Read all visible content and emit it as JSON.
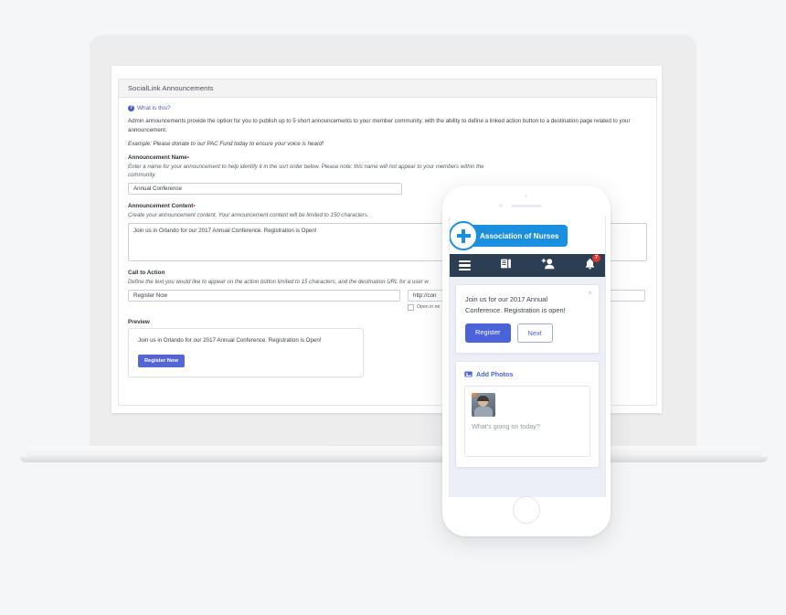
{
  "admin": {
    "card_title": "SocialLink Announcements",
    "what_is_this": "What is this?",
    "intro_paragraph": "Admin announcements provide the option for you to publish up to 5 short announcements to your member community, with the ability to define a linked action button to a destination page related to your announcement.",
    "example_text": "Example: Please donate to our PAC Fund today to ensure your voice is heard!",
    "announcement_name": {
      "label": "Announcement Name",
      "required_mark": "•",
      "help": "Enter a name for your announcement to help identify it in the sort order below. Please note: this name will not appear to your members within the community.",
      "value": "Annual Conference"
    },
    "announcement_content": {
      "label": "Announcement Content",
      "required_mark": "•",
      "help": "Create your announcement content. Your announcement content will be limited to 150 characters.",
      "value": "Join us in Orlando for our 2017 Annual Conference. Registration is Open!"
    },
    "call_to_action": {
      "label": "Call to Action",
      "help": "Define the text you would like to appear on the action button limited to 15 characters, and the destination URL for a user w",
      "button_text_value": "Register Now",
      "url_value": "http://con",
      "open_in_new_label": "Open in ne"
    },
    "preview": {
      "label": "Preview",
      "text": "Join us in Orlando for our 2017 Annual Conference. Registration is Open!",
      "button_label": "Register Now"
    }
  },
  "phone": {
    "logo_text": "Association of Nurses",
    "nav": {
      "menu_icon": "hamburger-icon",
      "documents_icon": "documents-icon",
      "add_person_icon": "add-person-icon",
      "bell_icon": "bell-icon",
      "bell_badge_count": "7"
    },
    "announcement": {
      "text": "Join us for our 2017 Annual Conference. Registration is open!",
      "close_glyph": "×",
      "primary_button": "Register",
      "secondary_button": "Next"
    },
    "composer": {
      "add_photos_label": "Add Photos",
      "placeholder": "What's going on today?"
    }
  },
  "colors": {
    "page_background": "#f5f6f7",
    "laptop_lid": "#ededee",
    "brand_blue": "#1a8fe0",
    "nav_navy": "#2c3e52",
    "button_indigo": "#4a63d8",
    "preview_button": "#5465d6",
    "badge_red": "#e0352b",
    "link_blue": "#4a5fc1",
    "required_red": "#d0454c",
    "phone_screen_bg": "#eceff5"
  }
}
